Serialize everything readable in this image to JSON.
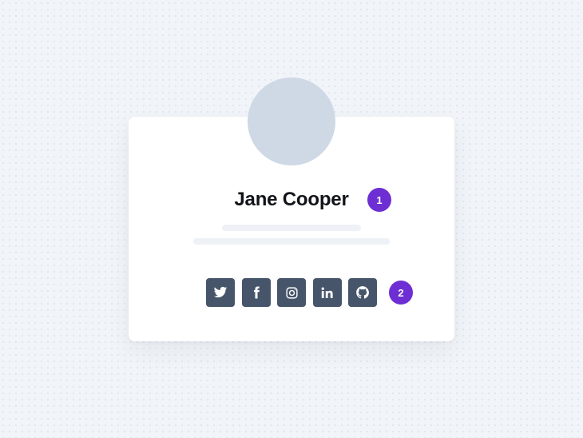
{
  "profile": {
    "name": "Jane Cooper"
  },
  "steps": {
    "first": "1",
    "second": "2"
  },
  "social_links": [
    {
      "icon": "twitter-icon"
    },
    {
      "icon": "facebook-icon"
    },
    {
      "icon": "instagram-icon"
    },
    {
      "icon": "linkedin-icon"
    },
    {
      "icon": "github-icon"
    }
  ],
  "colors": {
    "background": "#f1f4f8",
    "card": "#ffffff",
    "avatar_placeholder": "#cfd8e5",
    "name_text": "#111318",
    "step_badge": "#6d2ed4",
    "skeleton": "#eef2f7",
    "social_button": "#47556a"
  }
}
